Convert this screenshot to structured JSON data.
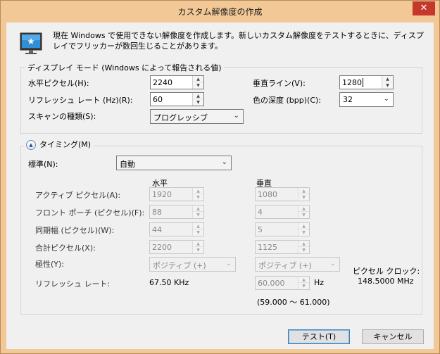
{
  "window": {
    "title": "カスタム解像度の作成",
    "close_glyph": "✕"
  },
  "icons": {
    "monitor": "monitor-icon",
    "close": "close-icon",
    "collapse": "chevron-up-icon"
  },
  "description": "現在 Windows で使用できない解像度を作成します。新しいカスタム解像度をテストするときに、ディスプレイでフリッカーが数回生じることがあります。",
  "display_mode": {
    "group_label": "ディスプレイ モード (Windows によって報告される値)",
    "horizontal_pixels": {
      "label": "水平ピクセル(H):",
      "value": "2240"
    },
    "vertical_lines": {
      "label": "垂直ライン(V):",
      "value": "1280"
    },
    "refresh_rate": {
      "label": "リフレッシュ レート (Hz)(R):",
      "value": "60"
    },
    "color_depth": {
      "label": "色の深度 (bpp)(C):",
      "value": "32"
    },
    "scan_type": {
      "label": "スキャンの種類(S):",
      "value": "プログレッシブ"
    }
  },
  "timing": {
    "toggle_label": "タイミング(M)",
    "standard": {
      "label": "標準(N):",
      "value": "自動"
    },
    "col_horizontal": "水平",
    "col_vertical": "垂直",
    "rows": [
      {
        "label": "アクティブ ピクセル(A):",
        "h": "1920",
        "v": "1080"
      },
      {
        "label": "フロント ポーチ (ピクセル)(F):",
        "h": "88",
        "v": "4"
      },
      {
        "label": "同期幅 (ピクセル)(W):",
        "h": "44",
        "v": "5"
      },
      {
        "label": "合計ピクセル(X):",
        "h": "2200",
        "v": "1125"
      }
    ],
    "polarity": {
      "label": "極性(Y):",
      "h": "ポジティブ (+)",
      "v": "ポジティブ (+)"
    },
    "refresh": {
      "label": "リフレッシュ レート:",
      "h": "67.50 KHz",
      "v": "60.000",
      "v_unit": "Hz",
      "range": "(59.000 ～ 61.000)"
    },
    "pixel_clock": {
      "label": "ピクセル クロック:",
      "value": "148.5000 MHz"
    }
  },
  "buttons": {
    "test": "テスト(T)",
    "cancel": "キャンセル"
  }
}
